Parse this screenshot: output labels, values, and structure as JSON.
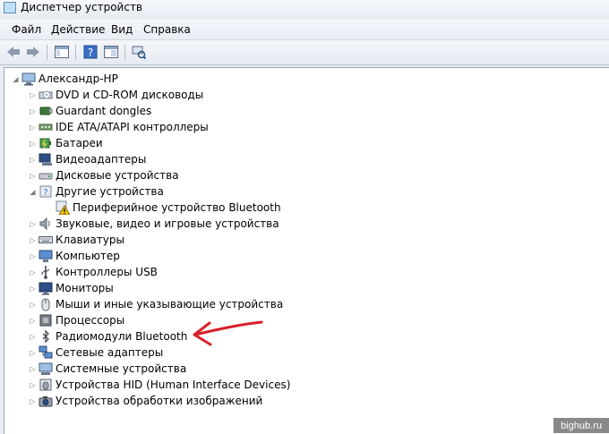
{
  "window": {
    "title": "Диспетчер устройств"
  },
  "menu": [
    "Файл",
    "Действие",
    "Вид",
    "Справка"
  ],
  "tree": {
    "root": "Александр-HP",
    "items": [
      {
        "label": "DVD и CD-ROM дисководы",
        "icon": "dvd-drive-icon"
      },
      {
        "label": "Guardant dongles",
        "icon": "usb-dongle-icon"
      },
      {
        "label": "IDE ATA/ATAPI контроллеры",
        "icon": "ide-controller-icon"
      },
      {
        "label": "Батареи",
        "icon": "battery-icon"
      },
      {
        "label": "Видеоадаптеры",
        "icon": "display-adapter-icon"
      },
      {
        "label": "Дисковые устройства",
        "icon": "disk-drive-icon"
      },
      {
        "label": "Другие устройства",
        "icon": "unknown-device-icon",
        "expanded": true
      },
      {
        "label": "Периферийное устройство Bluetooth",
        "icon": "warning-device-icon",
        "child": true
      },
      {
        "label": "Звуковые, видео и игровые устройства",
        "icon": "speaker-icon"
      },
      {
        "label": "Клавиатуры",
        "icon": "keyboard-icon"
      },
      {
        "label": "Компьютер",
        "icon": "computer-icon"
      },
      {
        "label": "Контроллеры USB",
        "icon": "usb-icon"
      },
      {
        "label": "Мониторы",
        "icon": "monitor-icon"
      },
      {
        "label": "Мыши и иные указывающие устройства",
        "icon": "mouse-icon"
      },
      {
        "label": "Процессоры",
        "icon": "processor-icon"
      },
      {
        "label": "Радиомодули Bluetooth",
        "icon": "bluetooth-icon"
      },
      {
        "label": "Сетевые адаптеры",
        "icon": "network-adapter-icon"
      },
      {
        "label": "Системные устройства",
        "icon": "system-device-icon"
      },
      {
        "label": "Устройства HID (Human Interface Devices)",
        "icon": "hid-icon"
      },
      {
        "label": "Устройства обработки изображений",
        "icon": "camera-icon"
      }
    ]
  },
  "watermark": "bighub.ru",
  "colors": {
    "annotation_arrow": "#d9202a",
    "selection": "#3399ff"
  }
}
